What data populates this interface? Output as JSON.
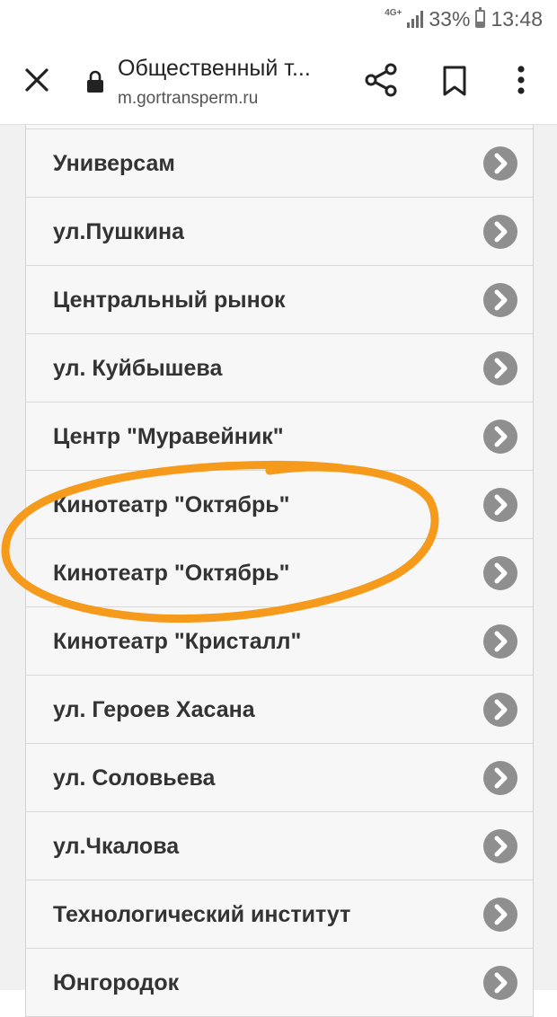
{
  "status_bar": {
    "network": "4G+",
    "battery_percent": "33%",
    "battery_level": 0.33,
    "time": "13:48"
  },
  "toolbar": {
    "title": "Общественный т...",
    "url": "m.gortransperm.ru",
    "icons": [
      "close-icon",
      "lock-icon",
      "share-icon",
      "bookmark-icon",
      "menu-icon"
    ]
  },
  "stops": [
    {
      "label": "Универсам"
    },
    {
      "label": "ул.Пушкина"
    },
    {
      "label": "Центральный рынок"
    },
    {
      "label": "ул. Куйбышева"
    },
    {
      "label": "Центр \"Муравейник\""
    },
    {
      "label": "Кинотеатр \"Октябрь\""
    },
    {
      "label": "Кинотеатр \"Октябрь\""
    },
    {
      "label": "Кинотеатр \"Кристалл\""
    },
    {
      "label": "ул. Героев Хасана"
    },
    {
      "label": "ул. Соловьева"
    },
    {
      "label": "ул.Чкалова"
    },
    {
      "label": "Технологический институт"
    },
    {
      "label": "Юнгородок"
    }
  ],
  "colors": {
    "arrow_circle": "#8f8f8f",
    "row_background": "#f7f7f7",
    "highlight_stroke": "#f59a1b"
  }
}
